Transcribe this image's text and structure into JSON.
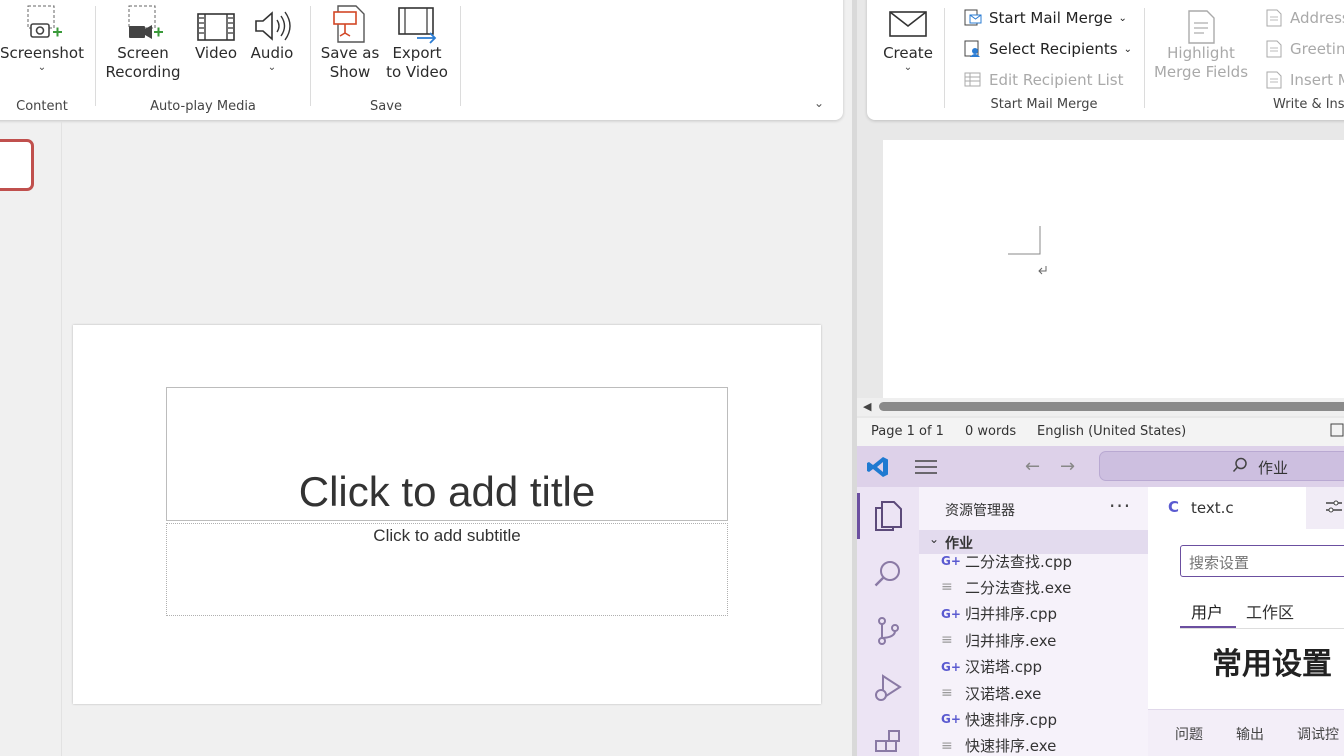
{
  "powerpoint": {
    "ribbon": {
      "buttons": {
        "screenshot": "Screenshot",
        "screen_recording": "Screen\nRecording",
        "video": "Video",
        "audio": "Audio",
        "save_as_show": "Save as\nShow",
        "export_to_video": "Export\nto Video"
      },
      "groups": {
        "content": "Content",
        "autoplay_media": "Auto-play Media",
        "save": "Save"
      }
    },
    "slide": {
      "title_placeholder": "Click to add title",
      "subtitle_placeholder": "Click to add subtitle"
    },
    "colors": {
      "thumbnail_selected": "#c0504d"
    }
  },
  "word": {
    "ribbon": {
      "create": "Create",
      "start_mail_merge": "Start Mail Merge",
      "select_recipients": "Select Recipients",
      "edit_recipient_list": "Edit Recipient List",
      "group_start_mail_merge": "Start Mail Merge",
      "highlight_merge_fields": "Highlight\nMerge Fields",
      "address": "Address",
      "greeting": "Greeting",
      "insert": "Insert M",
      "group_write_insert": "Write & Ins"
    },
    "status": {
      "page": "Page 1 of 1",
      "words": "0 words",
      "language": "English (United States)"
    }
  },
  "vscode": {
    "title_search": "作业",
    "explorer_header": "资源管理器",
    "folder_name": "作业",
    "files": [
      {
        "name": "二分法查找.cpp",
        "type": "cpp"
      },
      {
        "name": "二分法查找.exe",
        "type": "exe"
      },
      {
        "name": "归并排序.cpp",
        "type": "cpp"
      },
      {
        "name": "归并排序.exe",
        "type": "exe"
      },
      {
        "name": "汉诺塔.cpp",
        "type": "cpp"
      },
      {
        "name": "汉诺塔.exe",
        "type": "exe"
      },
      {
        "name": "快速排序.cpp",
        "type": "cpp"
      },
      {
        "name": "快速排序.exe",
        "type": "exe"
      }
    ],
    "editor_tab": "text.c",
    "settings": {
      "search_placeholder": "搜索设置",
      "tab_user": "用户",
      "tab_workspace": "工作区",
      "heading": "常用设置"
    },
    "panel": {
      "problems": "问题",
      "output": "输出",
      "debug_console": "调试控"
    },
    "colors": {
      "accent": "#6b4fa0",
      "title_bar": "#ddd1e9"
    }
  }
}
